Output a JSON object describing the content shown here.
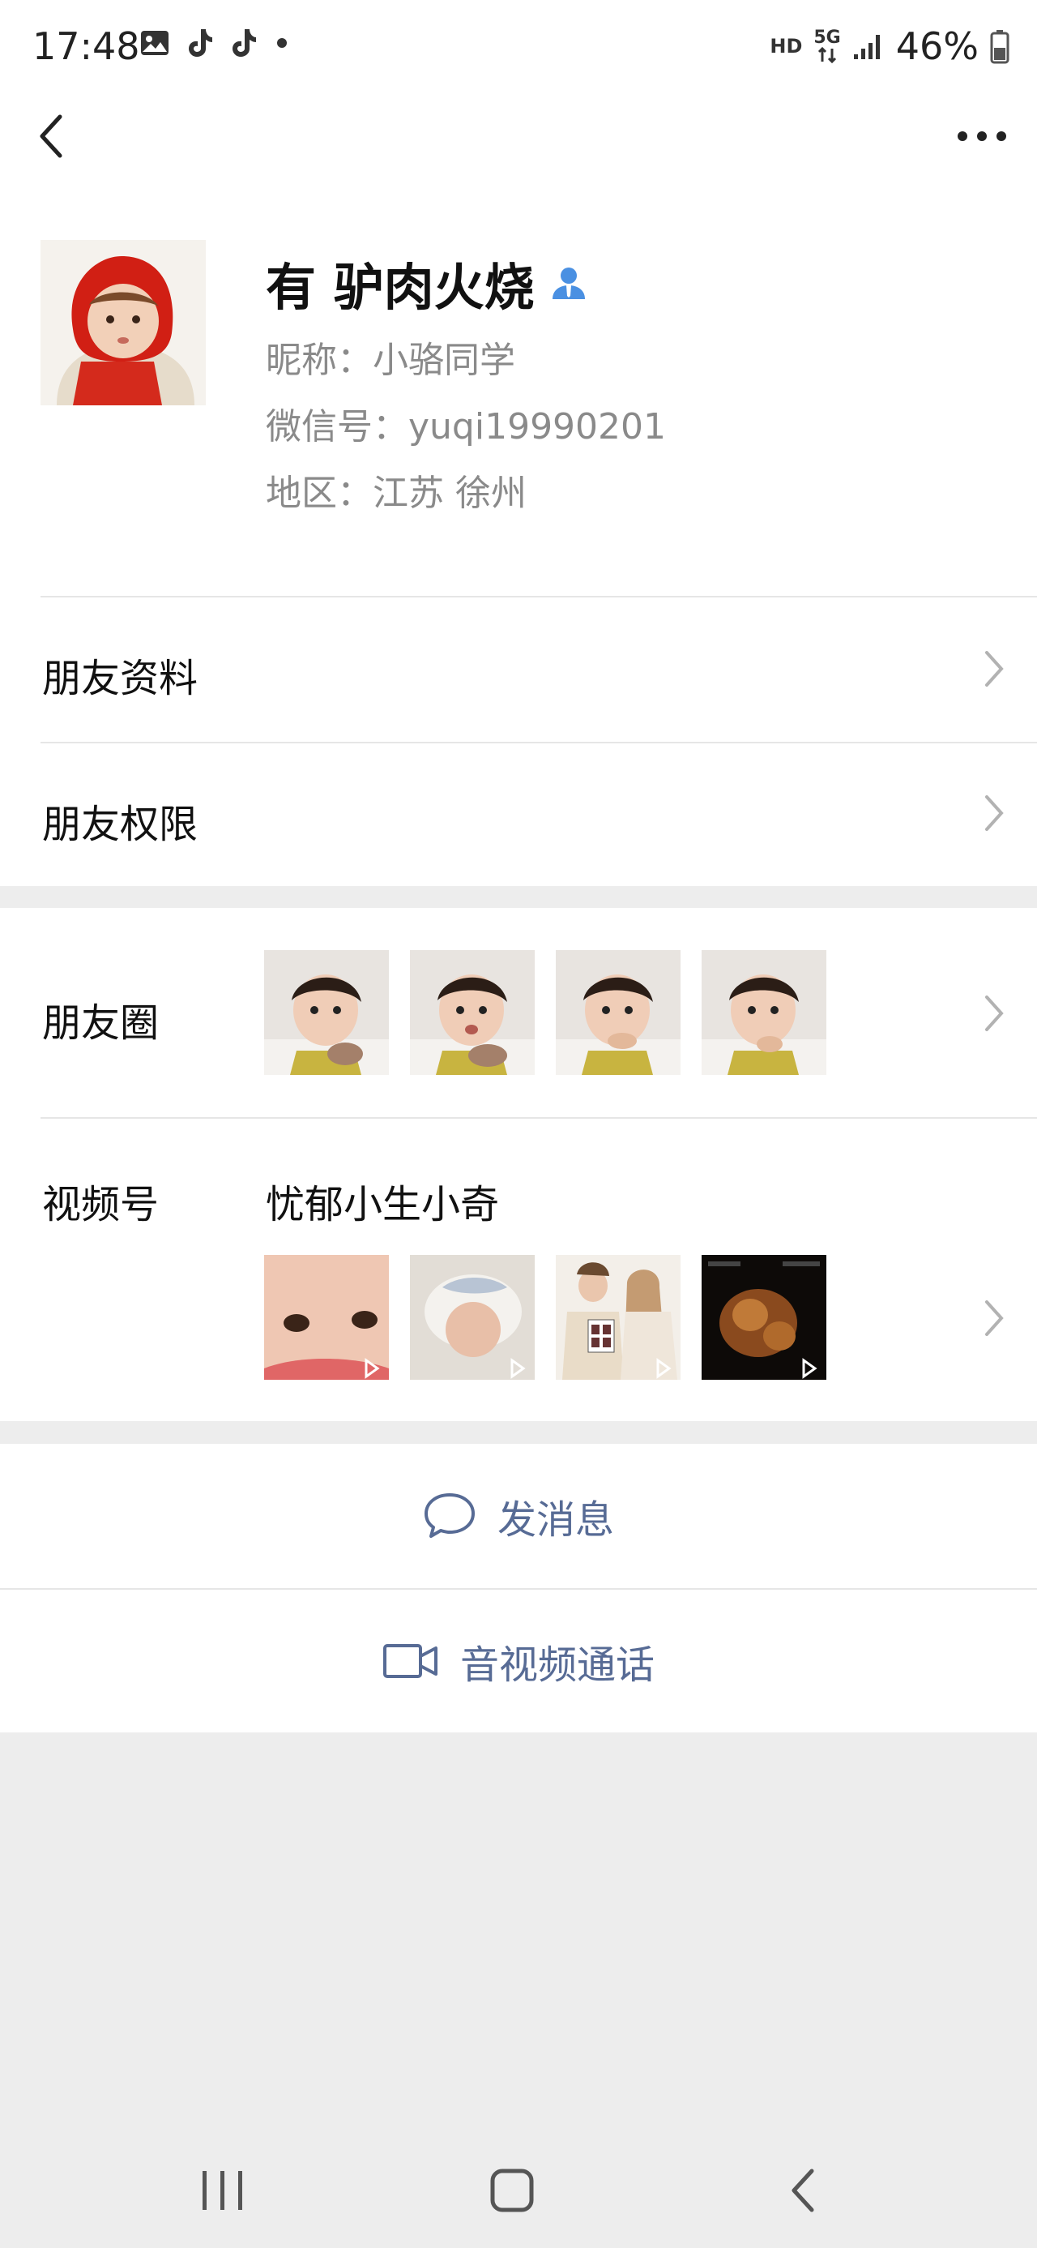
{
  "status_bar": {
    "time": "17:48",
    "network_hd": "HD",
    "network_5g": "5G",
    "battery": "46%"
  },
  "profile": {
    "name": "有 驴肉火烧",
    "nickname": "昵称：小骆同学",
    "wechat_id": "微信号：yuqi19990201",
    "region": "地区：江苏  徐州"
  },
  "menu": {
    "friend_info": "朋友资料",
    "friend_permissions": "朋友权限",
    "moments": "朋友圈",
    "channels": "视频号",
    "channels_name": "忧郁小生小奇"
  },
  "actions": {
    "send_message": "发消息",
    "av_call": "音视频通话"
  },
  "colors": {
    "link": "#576b95",
    "background": "#ededed",
    "text": "#111111",
    "secondary": "#8a8a8a"
  }
}
